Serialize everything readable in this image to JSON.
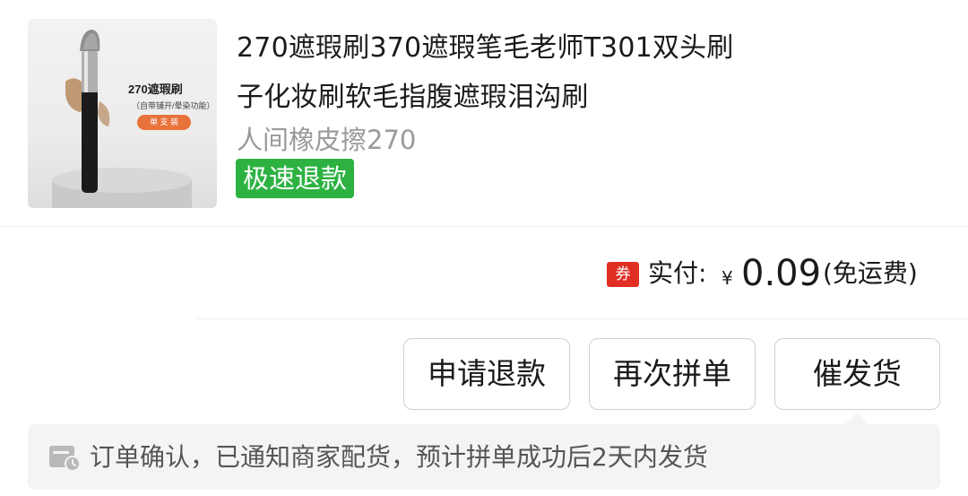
{
  "product": {
    "title_line1": "270遮瑕刷370遮瑕笔毛老师T301双头刷",
    "title_line2": "子化妆刷软毛指腹遮瑕泪沟刷",
    "shop_name": "人间橡皮擦270",
    "refund_badge": "极速退款",
    "image": {
      "caption_title": "270遮瑕刷",
      "caption_sub": "（自带铺开/晕染功能）",
      "caption_tag": "单 支 装"
    }
  },
  "payment": {
    "coupon_label": "券",
    "paid_label": "实付:",
    "currency_symbol": "¥",
    "amount": "0.09",
    "shipping_note": "(免运费)"
  },
  "actions": {
    "apply_refund": "申请退款",
    "group_again": "再次拼单",
    "urge_shipping": "催发货"
  },
  "notice": {
    "icon": "truck-clock-icon",
    "text": "订单确认，已通知商家配货，预计拼单成功后2天内发货"
  },
  "colors": {
    "refund_badge_bg": "#2db242",
    "coupon_bg": "#e02e24",
    "notice_bg": "#f4f4f4"
  }
}
